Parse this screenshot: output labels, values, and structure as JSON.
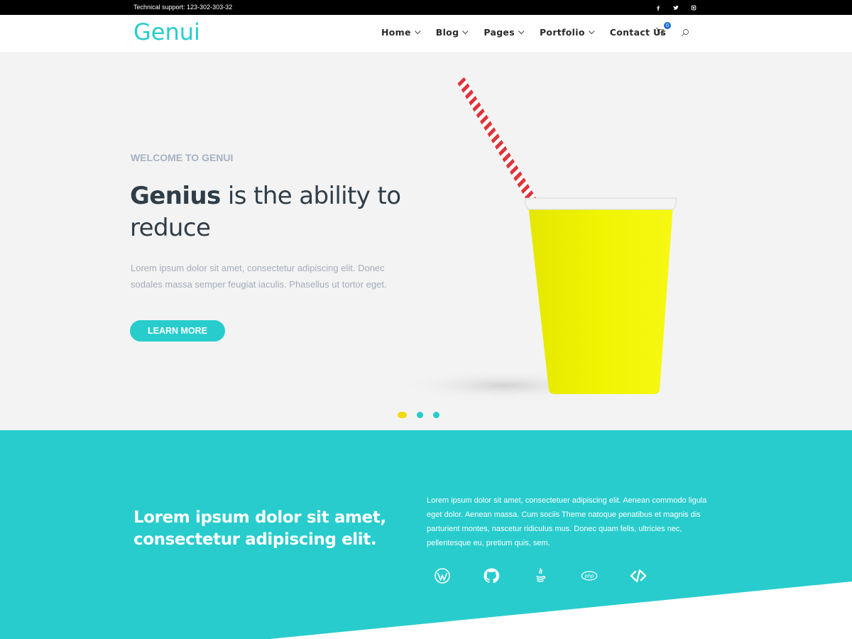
{
  "topbar": {
    "support_text": "Technical support: 123-302-303-32",
    "social": [
      {
        "icon": "facebook-icon"
      },
      {
        "icon": "twitter-icon"
      },
      {
        "icon": "instagram-icon"
      }
    ]
  },
  "header": {
    "logo": "Genui",
    "nav": [
      {
        "label": "Home",
        "has_dropdown": true
      },
      {
        "label": "Blog",
        "has_dropdown": true
      },
      {
        "label": "Pages",
        "has_dropdown": true
      },
      {
        "label": "Portfolio",
        "has_dropdown": true
      },
      {
        "label": "Contact Us",
        "has_dropdown": false
      }
    ],
    "cart_count": "0",
    "cart_icon": "cart-icon",
    "search_icon": "search-icon"
  },
  "hero": {
    "eyebrow": "WELCOME TO GENUI",
    "headline_strong": "Genius",
    "headline_rest": " is the ability to reduce",
    "lead": "Lorem ipsum dolor sit amet, consectetur adipiscing elit. Donec sodales massa semper feugiat iaculis. Phasellus ut tortor eget.",
    "cta_label": "LEARN MORE",
    "slides": 3,
    "active_slide": 0
  },
  "feature": {
    "title_line1": "Lorem ipsum dolor sit amet,",
    "title_line2": "consectetur adipiscing elit.",
    "text": "Lorem ipsum dolor sit amet, consectetuer adipiscing elit. Aenean commodo ligula eget dolor. Aenean massa. Cum sociis Theme natoque penatibus et magnis dis parturient montes, nascetur ridiculus mus. Donec quam felis, ultricies nec, pellentesque eu, pretium quis, sem.",
    "tech_icons": [
      "wordpress-icon",
      "github-icon",
      "java-icon",
      "php-icon",
      "code-icon"
    ]
  },
  "colors": {
    "accent": "#28cccd",
    "hero_bg": "#f3f3f3",
    "dot_active": "#f0da10",
    "cup": "#eef000"
  }
}
